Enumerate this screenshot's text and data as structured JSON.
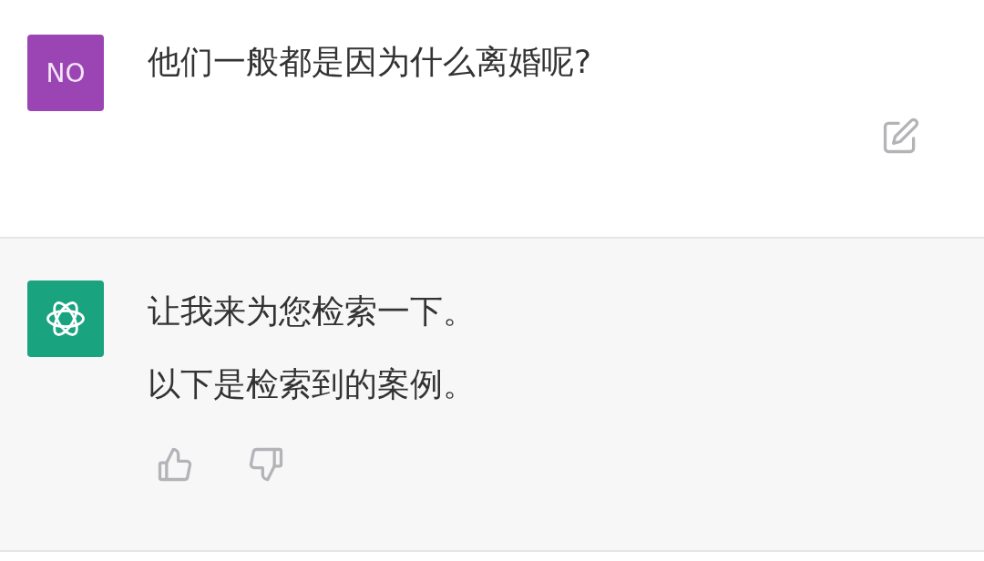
{
  "messages": [
    {
      "kind": "user",
      "avatar": "NO",
      "paragraphs": [
        "他们一般都是因为什么离婚呢?"
      ]
    },
    {
      "kind": "assistant",
      "paragraphs": [
        "让我来为您检索一下。",
        "以下是检索到的案例。"
      ]
    }
  ]
}
